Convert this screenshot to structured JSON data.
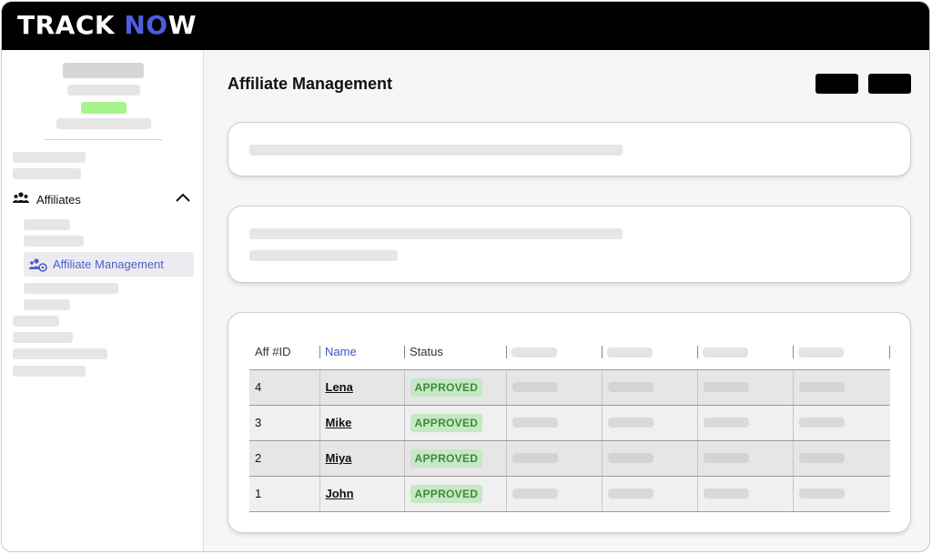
{
  "app": {
    "logo_main": "TRACK ",
    "logo_accent": "NO",
    "logo_tail": "W"
  },
  "sidebar": {
    "group": {
      "label": "Affiliates",
      "icon": "users-group-icon",
      "expanded": true
    },
    "active_item": {
      "label": "Affiliate Management",
      "icon": "users-gear-icon"
    }
  },
  "page": {
    "title": "Affiliate Management"
  },
  "table": {
    "columns": [
      "Aff #ID",
      "Name",
      "Status"
    ],
    "rows": [
      {
        "id": "4",
        "name": "Lena",
        "status": "APPROVED"
      },
      {
        "id": "3",
        "name": "Mike",
        "status": "APPROVED"
      },
      {
        "id": "2",
        "name": "Miya",
        "status": "APPROVED"
      },
      {
        "id": "1",
        "name": "John",
        "status": "APPROVED"
      }
    ]
  },
  "colors": {
    "brand_accent": "#4d5ee0",
    "active_nav_text": "#4d5ec9",
    "status_approved_bg": "#c6e8c4",
    "status_approved_text": "#3f8a3a"
  }
}
